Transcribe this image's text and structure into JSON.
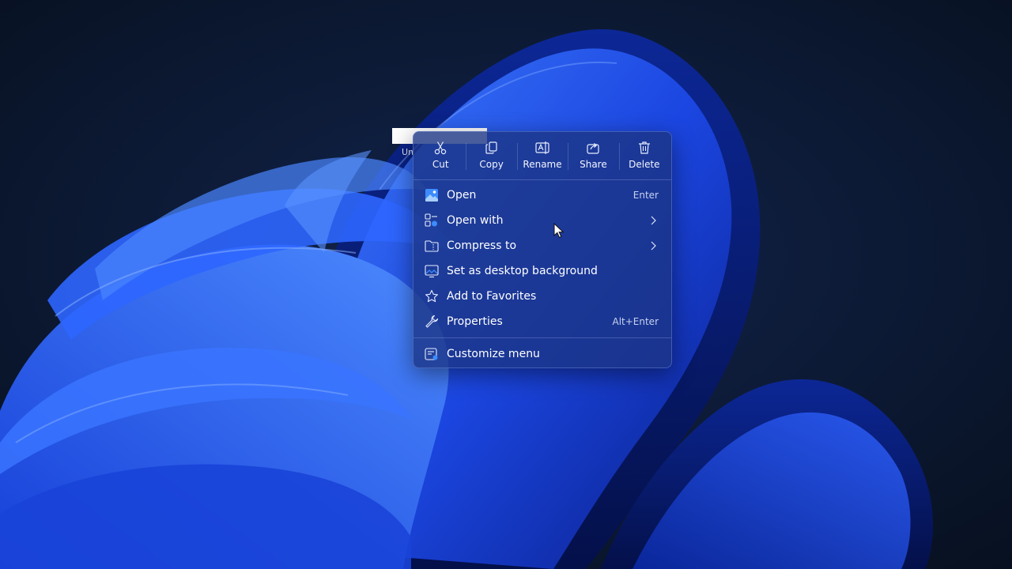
{
  "desktop": {
    "file_label": "Un"
  },
  "context_menu": {
    "quick_actions": [
      {
        "label": "Cut",
        "icon": "scissors-icon"
      },
      {
        "label": "Copy",
        "icon": "copy-icon"
      },
      {
        "label": "Rename",
        "icon": "rename-icon"
      },
      {
        "label": "Share",
        "icon": "share-icon"
      },
      {
        "label": "Delete",
        "icon": "trash-icon"
      }
    ],
    "items": [
      {
        "label": "Open",
        "shortcut": "Enter",
        "icon": "image-file-icon"
      },
      {
        "label": "Open with",
        "shortcut": "",
        "icon": "open-with-icon",
        "submenu": true
      },
      {
        "label": "Compress to",
        "shortcut": "",
        "icon": "zip-folder-icon",
        "submenu": true
      },
      {
        "label": "Set as desktop background",
        "shortcut": "",
        "icon": "wallpaper-icon"
      },
      {
        "label": "Add to Favorites",
        "shortcut": "",
        "icon": "star-icon"
      },
      {
        "label": "Properties",
        "shortcut": "Alt+Enter",
        "icon": "wrench-icon"
      },
      {
        "label": "Customize menu",
        "shortcut": "",
        "icon": "customize-menu-icon"
      }
    ]
  },
  "colors": {
    "menu_background": "#1c3484",
    "wallpaper_accent": "#1f4de0",
    "desktop_dark": "#0a1630"
  }
}
